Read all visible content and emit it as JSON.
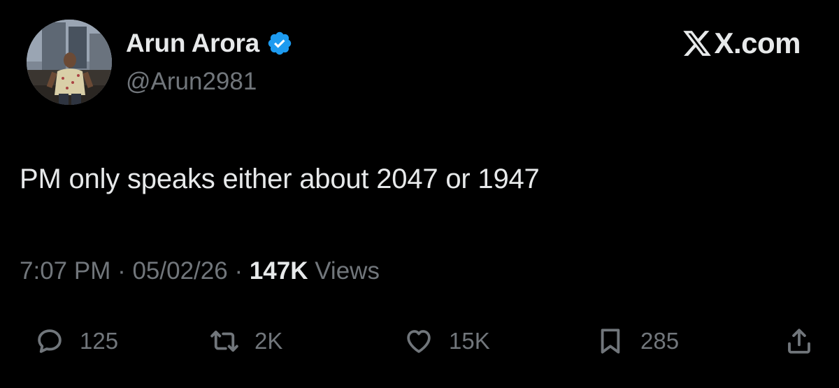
{
  "author": {
    "display_name": "Arun Arora",
    "handle": "@Arun2981",
    "verified": true
  },
  "brand": {
    "label": "X.com"
  },
  "tweet": {
    "text": "PM only speaks either about 2047 or 1947"
  },
  "meta": {
    "time": "7:07 PM",
    "separator": " · ",
    "date": "05/02/26",
    "views_count": "147K",
    "views_label": " Views"
  },
  "actions": {
    "replies": "125",
    "reposts": "2K",
    "likes": "15K",
    "bookmarks": "285"
  },
  "colors": {
    "background": "#000000",
    "primary_text": "#e7e9ea",
    "secondary_text": "#71767b",
    "verified_blue": "#1d9bf0"
  }
}
